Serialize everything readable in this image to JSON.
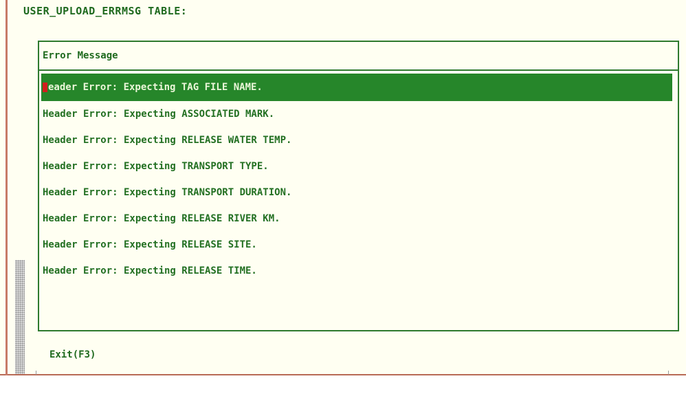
{
  "window": {
    "title": "USER_UPLOAD_ERRMSG TABLE:"
  },
  "grid": {
    "column_header": "Error Message",
    "rows": [
      {
        "message": "eader Error: Expecting TAG FILE NAME.",
        "cursor_char": "H",
        "selected": true
      },
      {
        "message": "Header Error: Expecting ASSOCIATED MARK."
      },
      {
        "message": "Header Error: Expecting RELEASE WATER TEMP."
      },
      {
        "message": "Header Error: Expecting TRANSPORT TYPE."
      },
      {
        "message": "Header Error: Expecting TRANSPORT DURATION."
      },
      {
        "message": "Header Error: Expecting RELEASE RIVER KM."
      },
      {
        "message": "Header Error: Expecting RELEASE SITE."
      },
      {
        "message": "Header Error: Expecting RELEASE TIME."
      }
    ]
  },
  "footer": {
    "exit_label": "Exit(F3)"
  },
  "colors": {
    "background": "#fffff2",
    "text_green": "#1f6a1f",
    "selection_green": "#26862a",
    "cursor_red": "#d21e1e"
  }
}
